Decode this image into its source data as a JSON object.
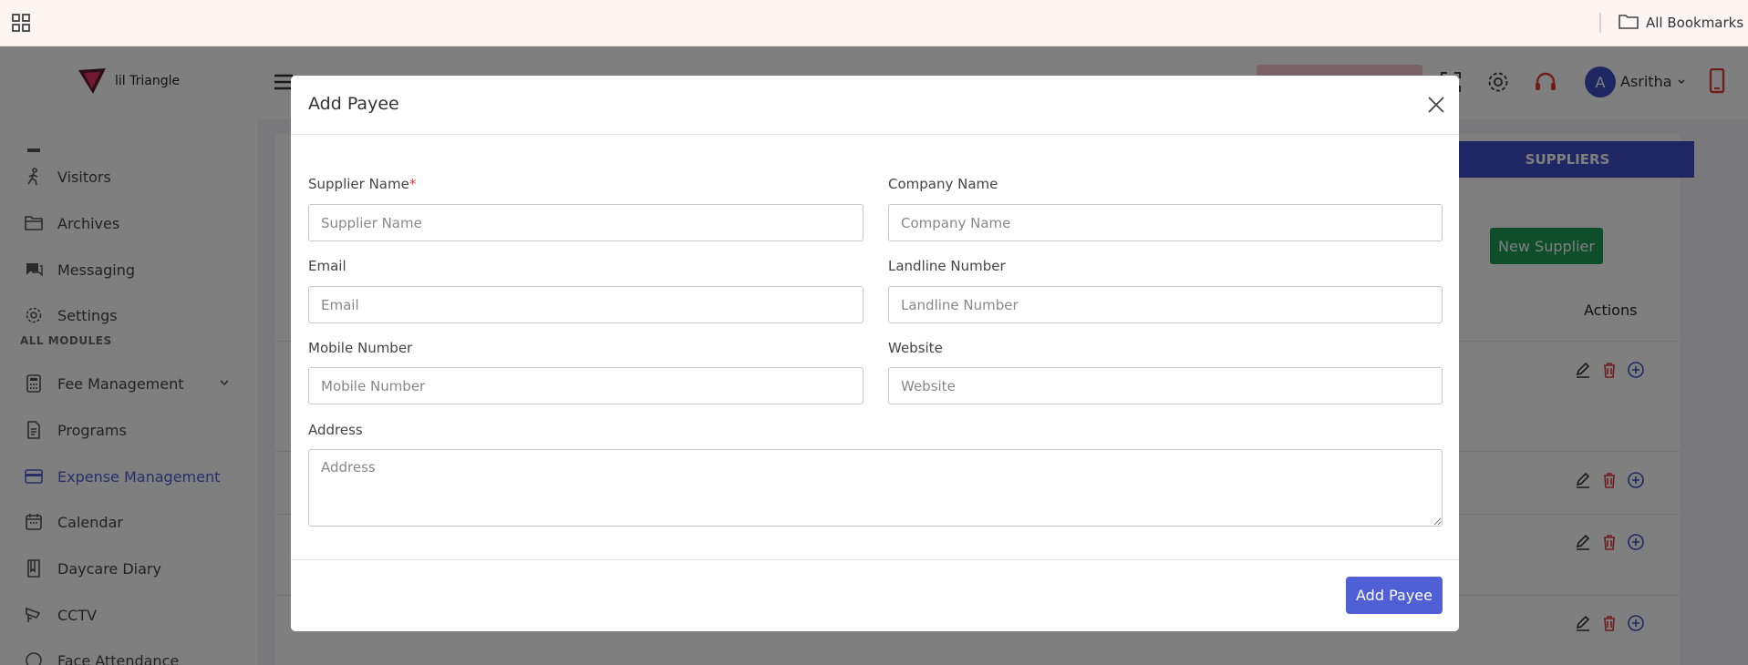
{
  "browser": {
    "bookmarks_label": "All Bookmarks"
  },
  "app": {
    "brand": "lil Triangle",
    "user": {
      "initial": "A",
      "name": "Asritha"
    },
    "sidebar": {
      "items_top": [
        {
          "label": "Visitors",
          "icon": "walking-person-icon"
        },
        {
          "label": "Archives",
          "icon": "folder-icon"
        },
        {
          "label": "Messaging",
          "icon": "chat-icon"
        },
        {
          "label": "Settings",
          "icon": "gear-icon"
        }
      ],
      "section_label": "ALL MODULES",
      "items_modules": [
        {
          "label": "Fee Management",
          "icon": "calculator-icon",
          "has_chevron": true
        },
        {
          "label": "Programs",
          "icon": "document-icon"
        },
        {
          "label": "Expense Management",
          "icon": "credit-card-icon",
          "active": true
        },
        {
          "label": "Calendar",
          "icon": "calendar-icon"
        },
        {
          "label": "Daycare Diary",
          "icon": "book-icon"
        },
        {
          "label": "CCTV",
          "icon": "camera-icon"
        },
        {
          "label": "Face Attendance",
          "icon": "face-icon"
        }
      ]
    },
    "page": {
      "tab_label": "SUPPLIERS",
      "new_supplier_label": "New Supplier",
      "actions_header": "Actions"
    }
  },
  "modal": {
    "title": "Add Payee",
    "fields": {
      "supplier_name": {
        "label": "Supplier Name",
        "required_mark": "*",
        "placeholder": "Supplier Name"
      },
      "company_name": {
        "label": "Company Name",
        "placeholder": "Company Name"
      },
      "email": {
        "label": "Email",
        "placeholder": "Email"
      },
      "landline": {
        "label": "Landline Number",
        "placeholder": "Landline Number"
      },
      "mobile": {
        "label": "Mobile Number",
        "placeholder": "Mobile Number"
      },
      "website": {
        "label": "Website",
        "placeholder": "Website"
      },
      "address": {
        "label": "Address",
        "placeholder": "Address"
      }
    },
    "submit_label": "Add Payee"
  },
  "colors": {
    "primary": "#4f5fd6",
    "tab_blue": "#3d4fc6",
    "success_green": "#1f9c54",
    "danger_red": "#e03a3a"
  }
}
